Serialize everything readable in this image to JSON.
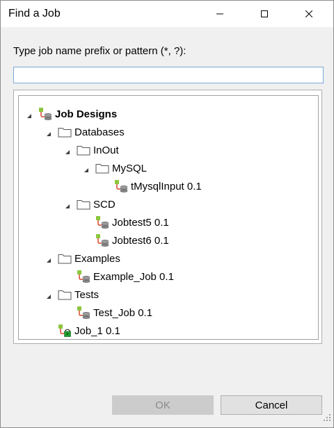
{
  "window": {
    "title": "Find a Job",
    "minimize_icon": "minimize-icon",
    "maximize_icon": "maximize-icon",
    "close_icon": "close-icon"
  },
  "search": {
    "label": "Type job name prefix or pattern (*, ?):",
    "value": "",
    "placeholder": ""
  },
  "tree": {
    "nodes": [
      {
        "label": "Job Designs",
        "icon": "job-designs-icon",
        "expanded": true,
        "level": 0
      },
      {
        "label": "Databases",
        "icon": "folder-icon",
        "expanded": true,
        "level": 1
      },
      {
        "label": "InOut",
        "icon": "folder-icon",
        "expanded": true,
        "level": 2
      },
      {
        "label": "MySQL",
        "icon": "folder-icon",
        "expanded": true,
        "level": 3
      },
      {
        "label": "tMysqlInput 0.1",
        "icon": "job-icon",
        "level": 4
      },
      {
        "label": "SCD",
        "icon": "folder-icon",
        "expanded": true,
        "level": 2
      },
      {
        "label": "Jobtest5 0.1",
        "icon": "job-icon",
        "level": 3
      },
      {
        "label": "Jobtest6 0.1",
        "icon": "job-icon",
        "level": 3
      },
      {
        "label": "Examples",
        "icon": "folder-icon",
        "expanded": true,
        "level": 1
      },
      {
        "label": "Example_Job 0.1",
        "icon": "job-icon",
        "level": 2
      },
      {
        "label": "Tests",
        "icon": "folder-icon",
        "expanded": true,
        "level": 1
      },
      {
        "label": "Test_Job 0.1",
        "icon": "job-icon",
        "level": 2
      },
      {
        "label": "Job_1 0.1",
        "icon": "locked-job-icon",
        "level": 1
      }
    ]
  },
  "buttons": {
    "ok_label": "OK",
    "ok_enabled": false,
    "cancel_label": "Cancel"
  },
  "colors": {
    "job_icon_green": "#8dc63f",
    "job_icon_red": "#d9472b",
    "lock_green": "#1e9e2e",
    "input_border": "#7aa7d8"
  }
}
